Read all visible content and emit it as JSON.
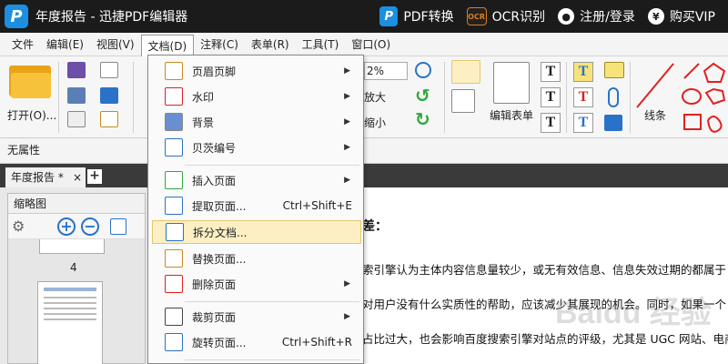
{
  "window": {
    "title": "年度报告 - 迅捷PDF编辑器",
    "logo_letter": "P",
    "actions": [
      {
        "label": "PDF转换",
        "icon": "pdf-convert-icon",
        "glyph": "P"
      },
      {
        "label": "OCR识别",
        "icon": "ocr-icon",
        "glyph": "OCR"
      },
      {
        "label": "注册/登录",
        "icon": "user-icon",
        "glyph": "●"
      },
      {
        "label": "购买VIP",
        "icon": "yen-icon",
        "glyph": "¥"
      }
    ]
  },
  "menubar": [
    {
      "label": "文件"
    },
    {
      "label": "编辑(E)"
    },
    {
      "label": "视图(V)"
    },
    {
      "label": "文档(D)",
      "active": true
    },
    {
      "label": "注释(C)"
    },
    {
      "label": "表单(R)"
    },
    {
      "label": "工具(T)"
    },
    {
      "label": "窗口(O)"
    }
  ],
  "ribbon": {
    "open_label": "打开(O)...",
    "zoom_value": "2%",
    "zoom_in_label": "放大",
    "zoom_out_label": "缩小",
    "edit_form_label": "编辑表单",
    "line_label": "线条",
    "text_glyph": "T"
  },
  "propbar": {
    "label": "无属性"
  },
  "tabs": [
    {
      "label": "年度报告 *",
      "close": "×"
    }
  ],
  "tab_add": "+",
  "thumbnails": {
    "title": "缩略图",
    "page_number": "4",
    "zoom_in": "+",
    "zoom_out": "−"
  },
  "document": {
    "heading": "差：",
    "lines": [
      "索引擎认为主体内容信息量较少，或无有效信息、信息失效过期的都属于",
      "对用户没有什么实质性的帮助，应该减少其展现的机会。同时，如果一个",
      "占比过大，也会影响百度搜索引擎对站点的评级，尤其是 UGC 网站、电商"
    ],
    "watermark": "Baidu 经验"
  },
  "dropdown": {
    "items": [
      {
        "label": "页眉页脚",
        "submenu": true,
        "icon": "header-footer-icon"
      },
      {
        "label": "水印",
        "submenu": true,
        "icon": "watermark-icon"
      },
      {
        "label": "背景",
        "submenu": true,
        "icon": "background-icon"
      },
      {
        "label": "贝茨编号",
        "submenu": true,
        "icon": "bates-number-icon"
      },
      {
        "label": "插入页面",
        "submenu": true,
        "icon": "insert-page-icon"
      },
      {
        "label": "提取页面...",
        "shortcut": "Ctrl+Shift+E",
        "icon": "extract-page-icon"
      },
      {
        "label": "拆分文档...",
        "highlighted": true,
        "icon": "split-document-icon"
      },
      {
        "label": "替换页面...",
        "icon": "replace-page-icon"
      },
      {
        "label": "删除页面",
        "submenu": true,
        "icon": "delete-page-icon"
      },
      {
        "label": "裁剪页面",
        "submenu": true,
        "icon": "crop-page-icon"
      },
      {
        "label": "旋转页面...",
        "shortcut": "Ctrl+Shift+R",
        "icon": "rotate-page-icon"
      }
    ],
    "arrow": "▶"
  },
  "colors": {
    "titlebar_bg": "#1b1b1b",
    "accent_blue": "#1d8ee0",
    "highlight": "#fcefc4",
    "red_shape": "#e02020"
  }
}
